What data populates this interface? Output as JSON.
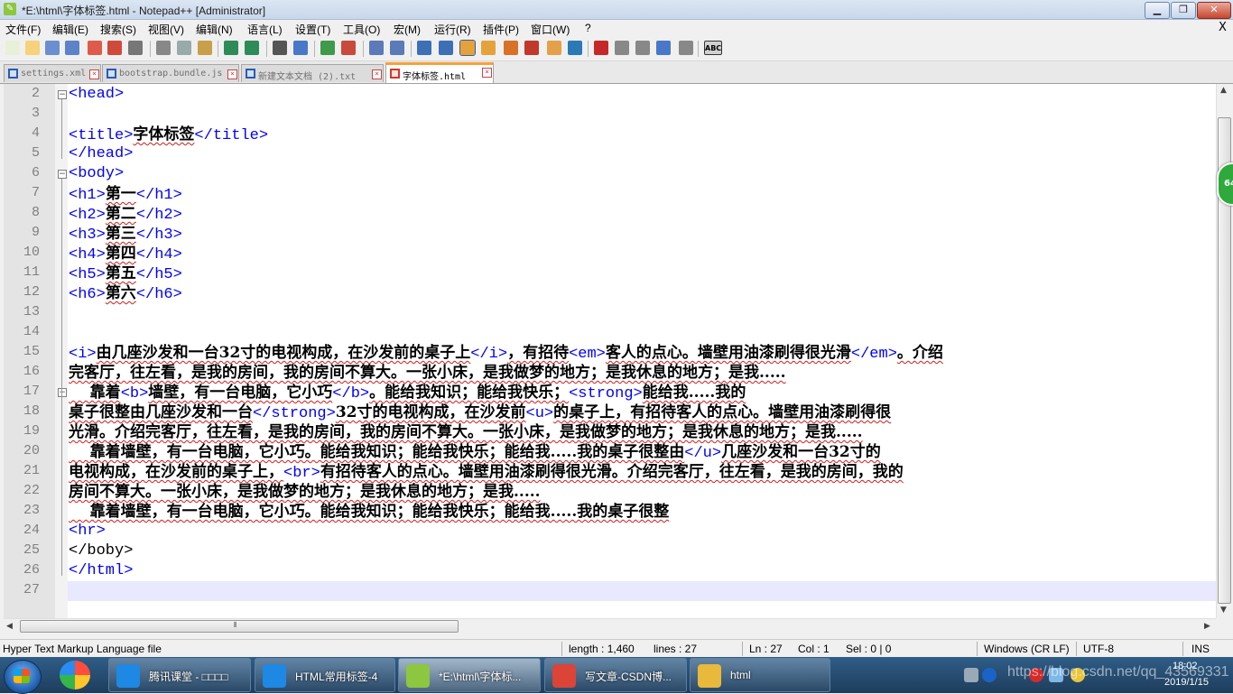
{
  "window": {
    "title": "*E:\\html\\字体标签.html - Notepad++ [Administrator]",
    "min": "▁",
    "max": "❐",
    "close": "✕"
  },
  "menu": [
    "文件(F)",
    "编辑(E)",
    "搜索(S)",
    "视图(V)",
    "编辑(N)",
    "语言(L)",
    "设置(T)",
    "工具(O)",
    "宏(M)",
    "运行(R)",
    "插件(P)",
    "窗口(W)",
    "?"
  ],
  "menu_close": "X",
  "toolbar": {
    "icons": [
      "new-file-icon",
      "open-file-icon",
      "save-icon",
      "save-all-icon",
      "close-icon",
      "close-all-icon",
      "print-icon",
      "cut-icon",
      "copy-icon",
      "paste-icon",
      "undo-icon",
      "redo-icon",
      "find-icon",
      "replace-icon",
      "zoom-in-icon",
      "zoom-out-icon",
      "sync-v-icon",
      "sync-h-icon",
      "wrap-icon",
      "all-chars-icon",
      "indent-guide-icon",
      "udl-icon",
      "doc-map-icon",
      "function-list-icon",
      "folder-workspace-icon",
      "monitor-icon",
      "record-macro-icon",
      "stop-macro-icon",
      "play-macro-icon",
      "run-macro-multiple-icon",
      "save-macro-icon",
      "spell-check-icon"
    ],
    "spell_label": "ABC"
  },
  "tabs": [
    {
      "label": "settings.xml",
      "icon": "blue"
    },
    {
      "label": "bootstrap.bundle.js",
      "icon": "blue"
    },
    {
      "label": "新建文本文档 (2).txt",
      "icon": "blue"
    },
    {
      "label": "字体标签.html",
      "icon": "red",
      "active": true
    }
  ],
  "editor": {
    "line_numbers": [
      "2",
      "3",
      "4",
      "5",
      "6",
      "7",
      "8",
      "9",
      "10",
      "11",
      "12",
      "13",
      "14",
      "15",
      "16",
      "17",
      "18",
      "19",
      "20",
      "21",
      "22",
      "23",
      "24",
      "25",
      "26",
      "27"
    ],
    "lines": [
      [
        {
          "t": "tag",
          "v": "<head>"
        }
      ],
      [],
      [
        {
          "t": "tag",
          "v": "<title>"
        },
        {
          "t": "cjk",
          "v": "字体标签"
        },
        {
          "t": "tag",
          "v": "</title>"
        }
      ],
      [
        {
          "t": "tag",
          "v": "</head>"
        }
      ],
      [
        {
          "t": "tag",
          "v": "<body>"
        }
      ],
      [
        {
          "t": "tag",
          "v": "<h1>"
        },
        {
          "t": "cjk",
          "v": "第一"
        },
        {
          "t": "tag",
          "v": "</h1>"
        }
      ],
      [
        {
          "t": "tag",
          "v": "<h2>"
        },
        {
          "t": "cjk",
          "v": "第二"
        },
        {
          "t": "tag",
          "v": "</h2>"
        }
      ],
      [
        {
          "t": "tag",
          "v": "<h3>"
        },
        {
          "t": "cjk",
          "v": "第三"
        },
        {
          "t": "tag",
          "v": "</h3>"
        }
      ],
      [
        {
          "t": "tag",
          "v": "<h4>"
        },
        {
          "t": "cjk",
          "v": "第四"
        },
        {
          "t": "tag",
          "v": "</h4>"
        }
      ],
      [
        {
          "t": "tag",
          "v": "<h5>"
        },
        {
          "t": "cjk",
          "v": "第五"
        },
        {
          "t": "tag",
          "v": "</h5>"
        }
      ],
      [
        {
          "t": "tag",
          "v": "<h6>"
        },
        {
          "t": "cjk",
          "v": "第六"
        },
        {
          "t": "tag",
          "v": "</h6>"
        }
      ],
      [],
      [],
      [
        {
          "t": "tag",
          "v": "<i>"
        },
        {
          "t": "cjk",
          "v": "由几座沙发和一台32寸的电视构成，在沙发前的桌子上"
        },
        {
          "t": "tag",
          "v": "</i>"
        },
        {
          "t": "cjk",
          "v": "，有招待"
        },
        {
          "t": "tag",
          "v": "<em>"
        },
        {
          "t": "cjk",
          "v": "客人的点心。墙壁用油漆刷得很光滑"
        },
        {
          "t": "tag",
          "v": "</em>"
        },
        {
          "t": "cjk",
          "v": "。介绍"
        }
      ],
      [
        {
          "t": "cjk",
          "v": "完客厅，往左看，是我的房间，我的房间不算大。一张小床，是我做梦的地方；是我休息的地方；是我....."
        }
      ],
      [
        {
          "t": "cjk",
          "v": "    靠着"
        },
        {
          "t": "tag",
          "v": "<b>"
        },
        {
          "t": "cjk",
          "v": "墙壁，有一台电脑，它小巧"
        },
        {
          "t": "tag",
          "v": "</b>"
        },
        {
          "t": "cjk",
          "v": "。能给我知识；能给我快乐；"
        },
        {
          "t": "tag",
          "v": "<strong>"
        },
        {
          "t": "cjk",
          "v": "能给我.....我的"
        }
      ],
      [
        {
          "t": "cjk",
          "v": "桌子很整由几座沙发和一台"
        },
        {
          "t": "tag",
          "v": "</strong>"
        },
        {
          "t": "cjk",
          "v": "32寸的电视构成，在沙发前"
        },
        {
          "t": "tag",
          "v": "<u>"
        },
        {
          "t": "cjk",
          "v": "的桌子上，有招待客人的点心。墙壁用油漆刷得很"
        }
      ],
      [
        {
          "t": "cjk",
          "v": "光滑。介绍完客厅，往左看，是我的房间，我的房间不算大。一张小床，是我做梦的地方；是我休息的地方；是我....."
        }
      ],
      [
        {
          "t": "cjk",
          "v": "    靠着墙壁，有一台电脑，它小巧。能给我知识；能给我快乐；能给我.....我的桌子很整由"
        },
        {
          "t": "tag",
          "v": "</u>"
        },
        {
          "t": "cjk",
          "v": "几座沙发和一台32寸的"
        }
      ],
      [
        {
          "t": "cjk",
          "v": "电视构成，在沙发前的桌子上，"
        },
        {
          "t": "tag",
          "v": "<br>"
        },
        {
          "t": "cjk",
          "v": "有招待客人的点心。墙壁用油漆刷得很光滑。介绍完客厅，往左看，是我的房间，我的"
        }
      ],
      [
        {
          "t": "cjk",
          "v": "房间不算大。一张小床，是我做梦的地方；是我休息的地方；是我....."
        }
      ],
      [
        {
          "t": "cjk",
          "v": "    靠着墙壁，有一台电脑，它小巧。能给我知识；能给我快乐；能给我.....我的桌子很整"
        }
      ],
      [
        {
          "t": "tag",
          "v": "<hr>"
        }
      ],
      [
        {
          "t": "txt",
          "v": "</boby>"
        }
      ],
      [
        {
          "t": "tag",
          "v": "</html>"
        }
      ],
      []
    ]
  },
  "scroll_arrows": {
    "up": "▲",
    "down": "▼",
    "left": "◀",
    "right": "▶",
    "grip": "⦀"
  },
  "status": {
    "file_type": "Hyper Text Markup Language file",
    "length": "length : 1,460",
    "lines": "lines : 27",
    "ln": "Ln : 27",
    "col": "Col : 1",
    "sel": "Sel : 0 | 0",
    "eol": "Windows (CR LF)",
    "encoding": "UTF-8",
    "mode": "INS"
  },
  "taskbar": {
    "tasks": [
      {
        "label": "腾讯课堂 - □□□□",
        "color": "#1e88e5"
      },
      {
        "label": "HTML常用标签-4",
        "color": "#1e88e5"
      },
      {
        "label": "*E:\\html\\字体标...",
        "color": "#8dc63f",
        "active": true
      },
      {
        "label": "写文章-CSDN博...",
        "color": "#db4437"
      },
      {
        "label": "html",
        "color": "#e8b93a"
      }
    ],
    "clock_time": "18:02",
    "clock_date": "2019/1/15",
    "watermark": "https://blog.csdn.net/qq_43569331"
  },
  "badge_text": "64"
}
